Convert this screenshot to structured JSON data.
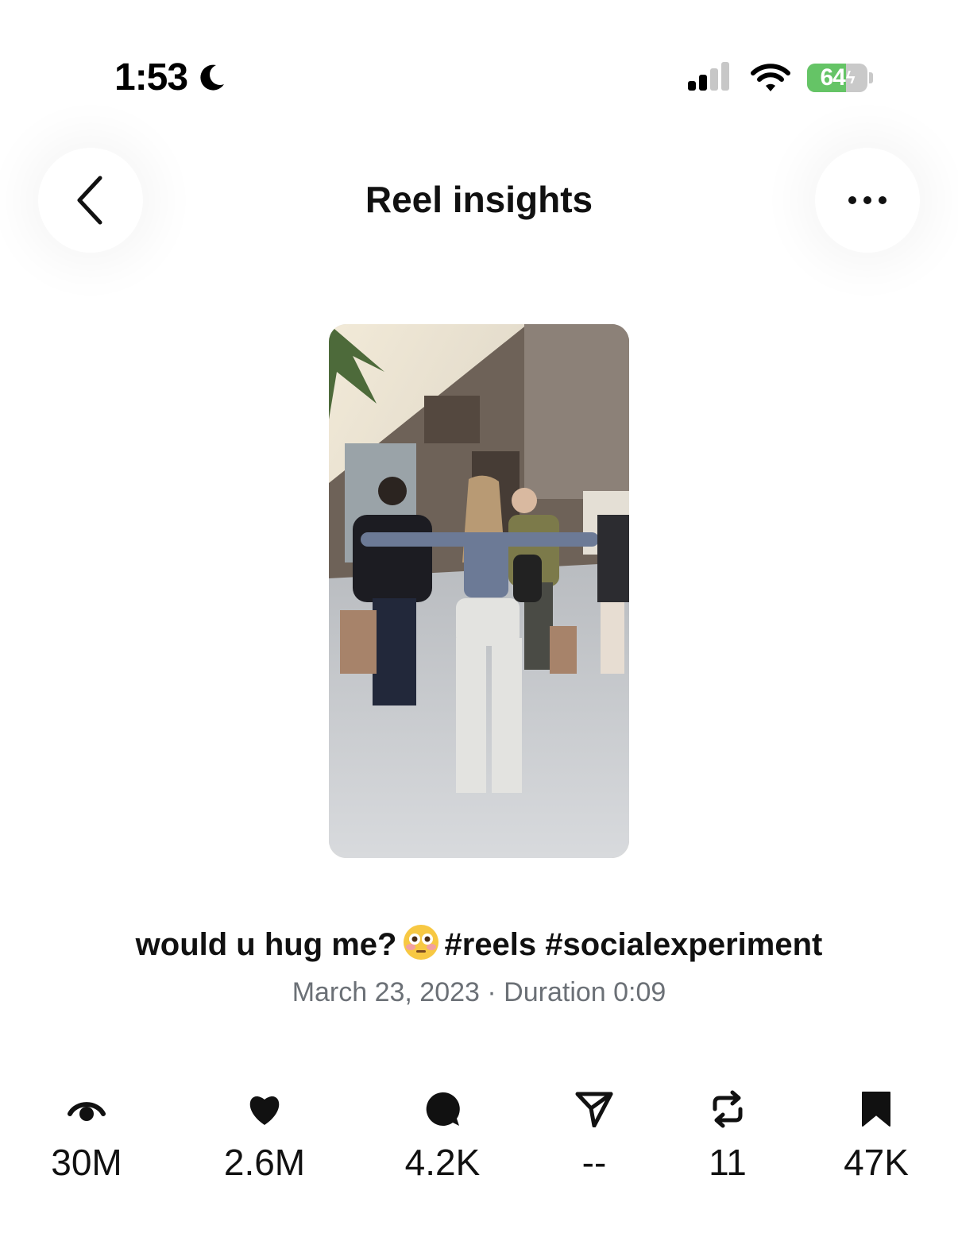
{
  "status_bar": {
    "time": "1:53",
    "battery_level": "64",
    "icons": [
      "moon-icon",
      "cellular-signal-icon",
      "wifi-icon",
      "battery-charging-icon"
    ]
  },
  "header": {
    "title": "Reel insights",
    "back_icon": "chevron-left-icon",
    "more_icon": "ellipsis-icon"
  },
  "reel": {
    "caption_text": "would u hug me?",
    "caption_emoji": "flushed-face-emoji",
    "hashtags": "#reels #socialexperiment",
    "date": "March 23, 2023",
    "separator": " · ",
    "duration": "Duration 0:09"
  },
  "stats": [
    {
      "icon": "eye-icon",
      "value": "30M"
    },
    {
      "icon": "heart-icon",
      "value": "2.6M"
    },
    {
      "icon": "comment-icon",
      "value": "4.2K"
    },
    {
      "icon": "send-icon",
      "value": "--"
    },
    {
      "icon": "repost-icon",
      "value": "11"
    },
    {
      "icon": "bookmark-icon",
      "value": "47K"
    }
  ],
  "colors": {
    "battery_green": "#65c466",
    "meta_gray": "#6b7076",
    "text": "#111111"
  }
}
